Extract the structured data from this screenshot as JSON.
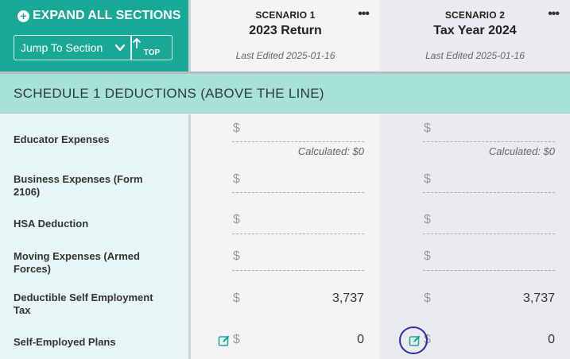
{
  "header": {
    "expand_all": "EXPAND ALL SECTIONS",
    "jump_to": "Jump To Section",
    "top": "TOP"
  },
  "scenarios": [
    {
      "label": "SCENARIO 1",
      "title": "2023 Return",
      "last_edited": "Last Edited 2025-01-16"
    },
    {
      "label": "SCENARIO 2",
      "title": "Tax Year 2024",
      "last_edited": "Last Edited 2025-01-16"
    }
  ],
  "more_icon": "•••",
  "section": {
    "title": "SCHEDULE 1 DEDUCTIONS (ABOVE THE LINE)"
  },
  "currency_symbol": "$",
  "rows": [
    {
      "label": "Educator Expenses",
      "s1": "",
      "s2": "",
      "s1_calc": "Calculated: $0",
      "s2_calc": "Calculated: $0"
    },
    {
      "label": "Business Expenses (Form 2106)",
      "s1": "",
      "s2": ""
    },
    {
      "label": "HSA Deduction",
      "s1": "",
      "s2": ""
    },
    {
      "label": "Moving Expenses (Armed Forces)",
      "s1": "",
      "s2": ""
    },
    {
      "label": "Deductible Self Employment Tax",
      "s1": "3,737",
      "s2": "3,737"
    },
    {
      "label": "Self-Employed Plans",
      "s1": "0",
      "s2": "0"
    }
  ],
  "colors": {
    "accent": "#1aa896",
    "section_bar": "#a8e1da",
    "label_column": "#e7f6f4",
    "scenario1_bg": "#f3f4f5",
    "scenario2_bg": "#e9ebee",
    "annotation_ring": "#2b2bb0"
  },
  "icons": {
    "expand": "plus-circle-icon",
    "jump_dropdown": "chevron-down-icon",
    "top": "arrow-up-icon",
    "more": "ellipsis-icon",
    "edit": "edit-pencil-icon"
  }
}
